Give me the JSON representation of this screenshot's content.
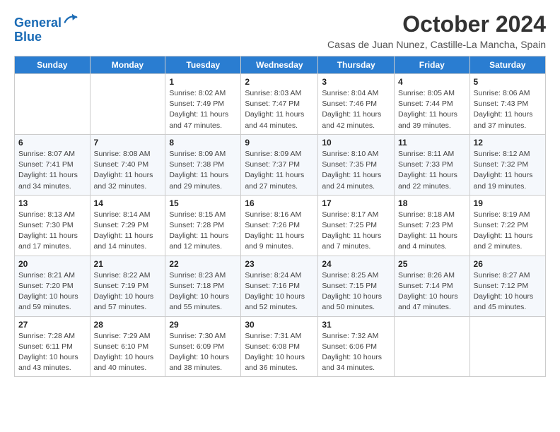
{
  "logo": {
    "line1": "General",
    "line2": "Blue"
  },
  "title": "October 2024",
  "subtitle": "Casas de Juan Nunez, Castille-La Mancha, Spain",
  "days_of_week": [
    "Sunday",
    "Monday",
    "Tuesday",
    "Wednesday",
    "Thursday",
    "Friday",
    "Saturday"
  ],
  "weeks": [
    [
      {
        "day": "",
        "info": ""
      },
      {
        "day": "",
        "info": ""
      },
      {
        "day": "1",
        "info": "Sunrise: 8:02 AM\nSunset: 7:49 PM\nDaylight: 11 hours and 47 minutes."
      },
      {
        "day": "2",
        "info": "Sunrise: 8:03 AM\nSunset: 7:47 PM\nDaylight: 11 hours and 44 minutes."
      },
      {
        "day": "3",
        "info": "Sunrise: 8:04 AM\nSunset: 7:46 PM\nDaylight: 11 hours and 42 minutes."
      },
      {
        "day": "4",
        "info": "Sunrise: 8:05 AM\nSunset: 7:44 PM\nDaylight: 11 hours and 39 minutes."
      },
      {
        "day": "5",
        "info": "Sunrise: 8:06 AM\nSunset: 7:43 PM\nDaylight: 11 hours and 37 minutes."
      }
    ],
    [
      {
        "day": "6",
        "info": "Sunrise: 8:07 AM\nSunset: 7:41 PM\nDaylight: 11 hours and 34 minutes."
      },
      {
        "day": "7",
        "info": "Sunrise: 8:08 AM\nSunset: 7:40 PM\nDaylight: 11 hours and 32 minutes."
      },
      {
        "day": "8",
        "info": "Sunrise: 8:09 AM\nSunset: 7:38 PM\nDaylight: 11 hours and 29 minutes."
      },
      {
        "day": "9",
        "info": "Sunrise: 8:09 AM\nSunset: 7:37 PM\nDaylight: 11 hours and 27 minutes."
      },
      {
        "day": "10",
        "info": "Sunrise: 8:10 AM\nSunset: 7:35 PM\nDaylight: 11 hours and 24 minutes."
      },
      {
        "day": "11",
        "info": "Sunrise: 8:11 AM\nSunset: 7:33 PM\nDaylight: 11 hours and 22 minutes."
      },
      {
        "day": "12",
        "info": "Sunrise: 8:12 AM\nSunset: 7:32 PM\nDaylight: 11 hours and 19 minutes."
      }
    ],
    [
      {
        "day": "13",
        "info": "Sunrise: 8:13 AM\nSunset: 7:30 PM\nDaylight: 11 hours and 17 minutes."
      },
      {
        "day": "14",
        "info": "Sunrise: 8:14 AM\nSunset: 7:29 PM\nDaylight: 11 hours and 14 minutes."
      },
      {
        "day": "15",
        "info": "Sunrise: 8:15 AM\nSunset: 7:28 PM\nDaylight: 11 hours and 12 minutes."
      },
      {
        "day": "16",
        "info": "Sunrise: 8:16 AM\nSunset: 7:26 PM\nDaylight: 11 hours and 9 minutes."
      },
      {
        "day": "17",
        "info": "Sunrise: 8:17 AM\nSunset: 7:25 PM\nDaylight: 11 hours and 7 minutes."
      },
      {
        "day": "18",
        "info": "Sunrise: 8:18 AM\nSunset: 7:23 PM\nDaylight: 11 hours and 4 minutes."
      },
      {
        "day": "19",
        "info": "Sunrise: 8:19 AM\nSunset: 7:22 PM\nDaylight: 11 hours and 2 minutes."
      }
    ],
    [
      {
        "day": "20",
        "info": "Sunrise: 8:21 AM\nSunset: 7:20 PM\nDaylight: 10 hours and 59 minutes."
      },
      {
        "day": "21",
        "info": "Sunrise: 8:22 AM\nSunset: 7:19 PM\nDaylight: 10 hours and 57 minutes."
      },
      {
        "day": "22",
        "info": "Sunrise: 8:23 AM\nSunset: 7:18 PM\nDaylight: 10 hours and 55 minutes."
      },
      {
        "day": "23",
        "info": "Sunrise: 8:24 AM\nSunset: 7:16 PM\nDaylight: 10 hours and 52 minutes."
      },
      {
        "day": "24",
        "info": "Sunrise: 8:25 AM\nSunset: 7:15 PM\nDaylight: 10 hours and 50 minutes."
      },
      {
        "day": "25",
        "info": "Sunrise: 8:26 AM\nSunset: 7:14 PM\nDaylight: 10 hours and 47 minutes."
      },
      {
        "day": "26",
        "info": "Sunrise: 8:27 AM\nSunset: 7:12 PM\nDaylight: 10 hours and 45 minutes."
      }
    ],
    [
      {
        "day": "27",
        "info": "Sunrise: 7:28 AM\nSunset: 6:11 PM\nDaylight: 10 hours and 43 minutes."
      },
      {
        "day": "28",
        "info": "Sunrise: 7:29 AM\nSunset: 6:10 PM\nDaylight: 10 hours and 40 minutes."
      },
      {
        "day": "29",
        "info": "Sunrise: 7:30 AM\nSunset: 6:09 PM\nDaylight: 10 hours and 38 minutes."
      },
      {
        "day": "30",
        "info": "Sunrise: 7:31 AM\nSunset: 6:08 PM\nDaylight: 10 hours and 36 minutes."
      },
      {
        "day": "31",
        "info": "Sunrise: 7:32 AM\nSunset: 6:06 PM\nDaylight: 10 hours and 34 minutes."
      },
      {
        "day": "",
        "info": ""
      },
      {
        "day": "",
        "info": ""
      }
    ]
  ]
}
